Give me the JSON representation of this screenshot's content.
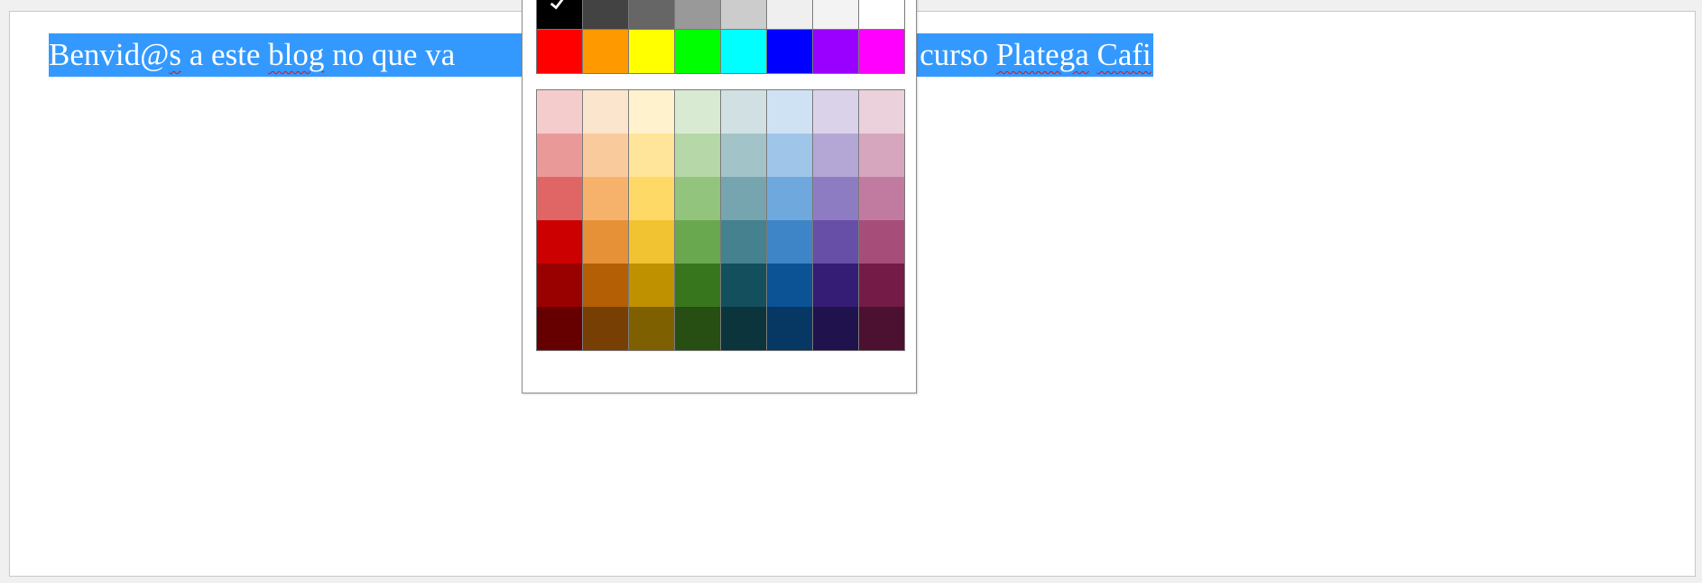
{
  "editor": {
    "selected_text": [
      {
        "text": "Benvid@",
        "misspelled": false
      },
      {
        "text": "s",
        "misspelled": true
      },
      {
        "text": " a este ",
        "misspelled": false
      },
      {
        "text": "blog",
        "misspelled": true
      },
      {
        "text": " no que va",
        "misspelled": false
      },
      {
        "text": "",
        "misspelled": false
      },
      {
        "text": "cias do curso ",
        "misspelled": false
      },
      {
        "text": "Platega",
        "misspelled": true
      },
      {
        "text": " ",
        "misspelled": false
      },
      {
        "text": "Cafi",
        "misspelled": true
      }
    ]
  },
  "color_picker": {
    "selected_color": "#000000",
    "grayscale_row": [
      "#000000",
      "#434343",
      "#666666",
      "#999999",
      "#cccccc",
      "#efefef",
      "#f3f3f3",
      "#ffffff"
    ],
    "bright_row": [
      "#ff0000",
      "#ff9900",
      "#ffff00",
      "#00ff00",
      "#00ffff",
      "#0000ff",
      "#9900ff",
      "#ff00ff"
    ],
    "shade_rows": [
      [
        "#f4cccc",
        "#fce5cd",
        "#fff2cc",
        "#d9ead3",
        "#d0e0e3",
        "#cfe2f3",
        "#d9d2e9",
        "#ead1dc"
      ],
      [
        "#ea9999",
        "#f9cb9c",
        "#ffe599",
        "#b6d7a8",
        "#a2c4c9",
        "#9fc5e8",
        "#b4a7d6",
        "#d5a6bd"
      ],
      [
        "#e06666",
        "#f6b26b",
        "#ffd966",
        "#93c47d",
        "#76a5af",
        "#6fa8dc",
        "#8e7cc3",
        "#c27ba0"
      ],
      [
        "#cc0000",
        "#e69138",
        "#f1c232",
        "#6aa84f",
        "#45818e",
        "#3d85c6",
        "#674ea7",
        "#a64d79"
      ],
      [
        "#990000",
        "#b45f06",
        "#bf9000",
        "#38761d",
        "#134f5c",
        "#0b5394",
        "#351c75",
        "#741b47"
      ],
      [
        "#660000",
        "#783f04",
        "#7f6000",
        "#274e13",
        "#0c343d",
        "#073763",
        "#20124d",
        "#4c1130"
      ]
    ]
  }
}
